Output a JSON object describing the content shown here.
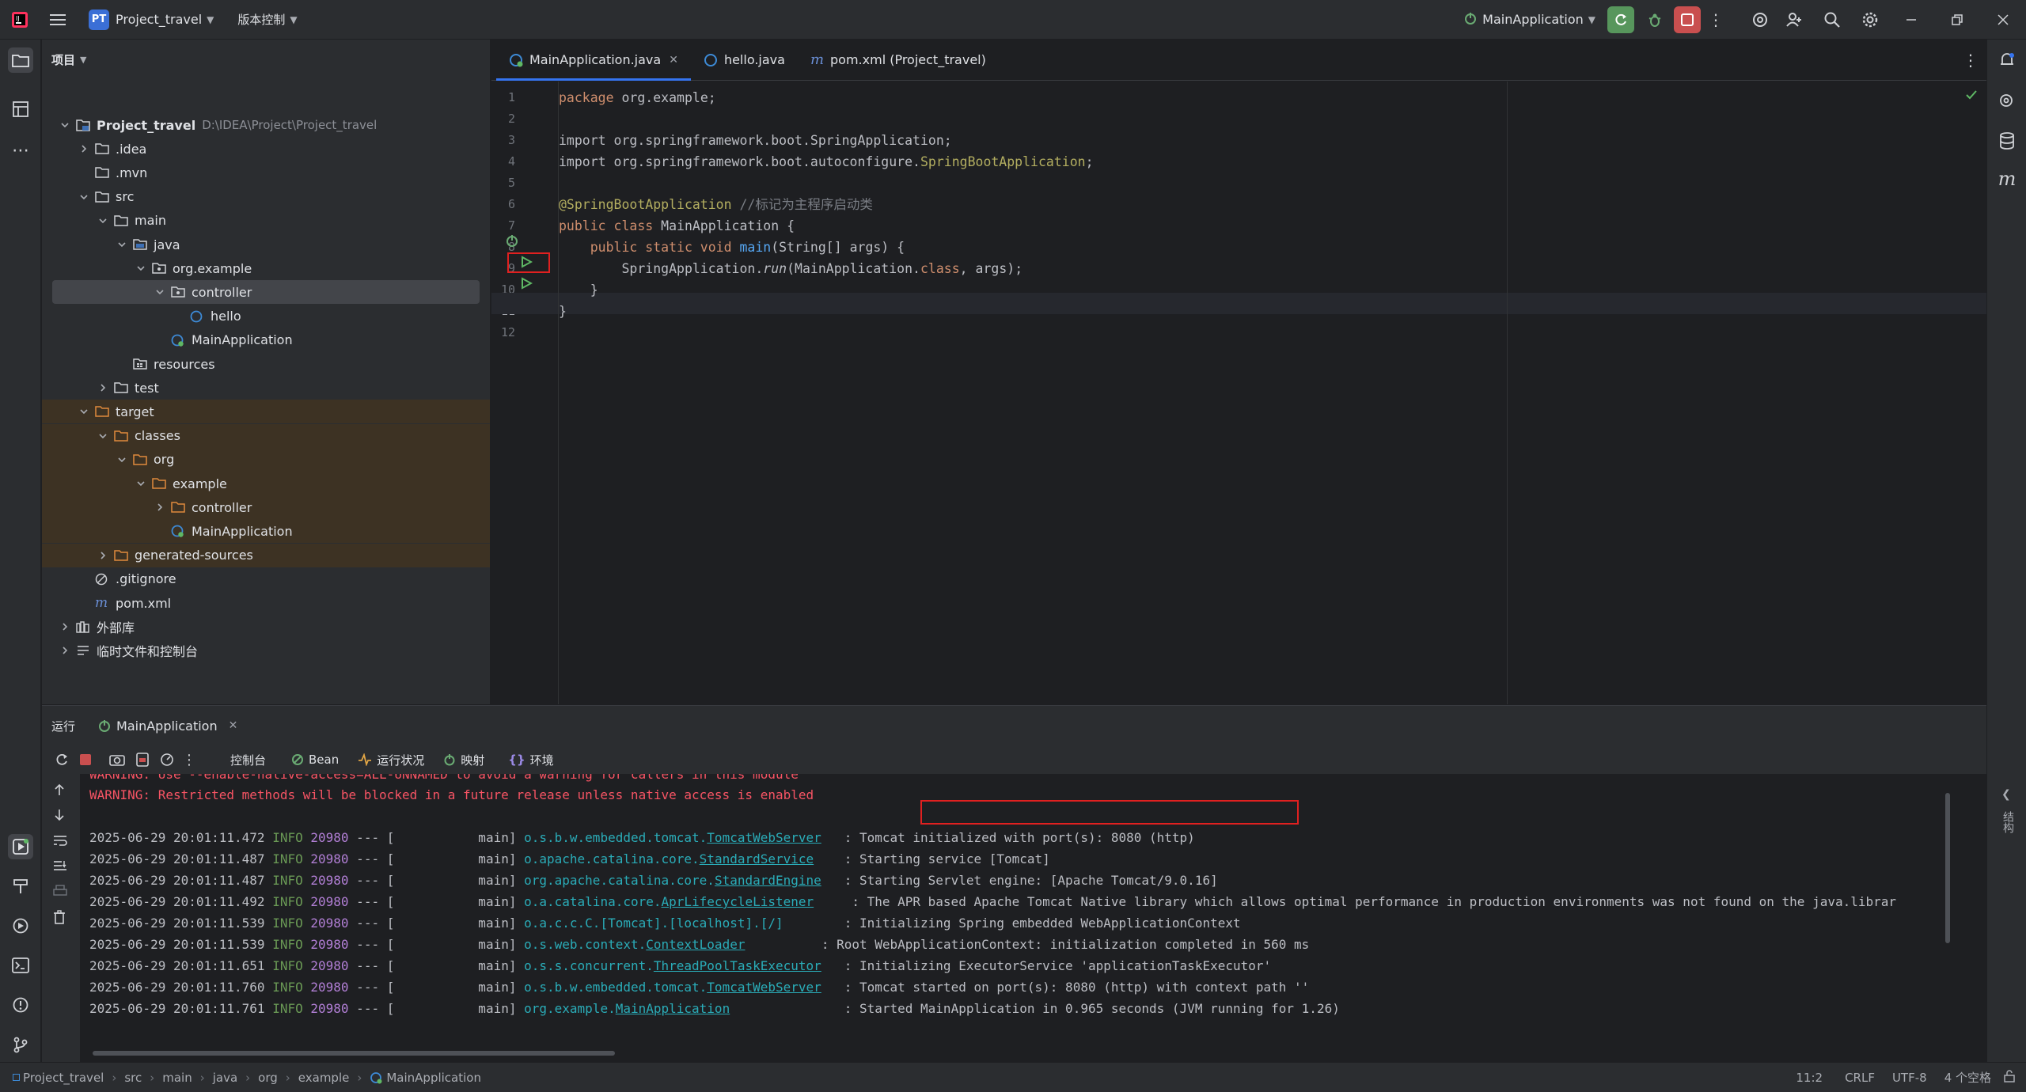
{
  "titlebar": {
    "project_badge": "PT",
    "project_name": "Project_travel",
    "vcs": "版本控制",
    "run_config": "MainApplication"
  },
  "project_panel": {
    "title": "项目",
    "tree": [
      {
        "label": "Project_travel",
        "path": "D:\\IDEA\\Project\\Project_travel"
      },
      {
        "label": ".idea"
      },
      {
        "label": ".mvn"
      },
      {
        "label": "src"
      },
      {
        "label": "main"
      },
      {
        "label": "java"
      },
      {
        "label": "org.example"
      },
      {
        "label": "controller"
      },
      {
        "label": "hello"
      },
      {
        "label": "MainApplication"
      },
      {
        "label": "resources"
      },
      {
        "label": "test"
      },
      {
        "label": "target"
      },
      {
        "label": "classes"
      },
      {
        "label": "org"
      },
      {
        "label": "example"
      },
      {
        "label": "controller"
      },
      {
        "label": "MainApplication"
      },
      {
        "label": "generated-sources"
      },
      {
        "label": ".gitignore"
      },
      {
        "label": "pom.xml"
      },
      {
        "label": "外部库"
      },
      {
        "label": "临时文件和控制台"
      }
    ]
  },
  "editor": {
    "tabs": [
      {
        "label": "MainApplication.java"
      },
      {
        "label": "hello.java"
      },
      {
        "label": "pom.xml (Project_travel)"
      }
    ],
    "line_numbers": [
      "1",
      "2",
      "3",
      "4",
      "5",
      "6",
      "7",
      "8",
      "9",
      "10",
      "11",
      "12"
    ],
    "code": {
      "l1": "package org.example;",
      "l3": "import org.springframework.boot.SpringApplication;",
      "l4a": "import org.springframework.boot.autoconfigure.",
      "l4b": "SpringBootApplication",
      ";": ";",
      "l6a": "@SpringBootApplication",
      "l6b": " //标记为主程序启动类",
      "l7a": "public class ",
      "l7b": "MainApplication {",
      "l8a": "    public static void ",
      "l8b": "main",
      "l8c": "(String[] args) {",
      "l9a": "        SpringApplication.",
      "l9b": "run",
      "l9c": "(MainApplication.",
      "l9d": "class",
      ", args);": ", args);",
      "l10": "    }",
      "l11": "}"
    }
  },
  "run_panel": {
    "tab_run": "运行",
    "tab_app": "MainApplication",
    "tools": {
      "console": "控制台",
      "bean": "Bean",
      "health": "运行状况",
      "mappings": "映射",
      "env": "环境"
    },
    "warn_top": "WARNING: Use --enable-native-access=ALL-UNNAMED to avoid a warning for callers in this module",
    "warn": "WARNING: Restricted methods will be blocked in a future release unless native access is enabled",
    "logs": [
      {
        "ts": "2025-06-29 20:01:11.472",
        "lvl": "INFO",
        "pid": "20980",
        "mid": " --- [           main] ",
        "lpre": "o.s.b.w.embedded.tomcat.",
        "lcls": "TomcatWebServer",
        "pad": "  ",
        "msg": ": Tomcat initialized with port(s): 8080 (http)"
      },
      {
        "ts": "2025-06-29 20:01:11.487",
        "lvl": "INFO",
        "pid": "20980",
        "mid": " --- [           main] ",
        "lpre": "o.apache.catalina.core.",
        "lcls": "StandardService",
        "pad": "   ",
        "msg": ": Starting service [Tomcat]"
      },
      {
        "ts": "2025-06-29 20:01:11.487",
        "lvl": "INFO",
        "pid": "20980",
        "mid": " --- [           main] ",
        "lpre": "org.apache.catalina.core.",
        "lcls": "StandardEngine",
        "pad": "  ",
        "msg": ": Starting Servlet engine: [Apache Tomcat/9.0.16]"
      },
      {
        "ts": "2025-06-29 20:01:11.492",
        "lvl": "INFO",
        "pid": "20980",
        "mid": " --- [           main] ",
        "lpre": "o.a.catalina.core.",
        "lcls": "AprLifecycleListener",
        "pad": "    ",
        "msg": ": The APR based Apache Tomcat Native library which allows optimal performance in production environments was not found on the java.librar"
      },
      {
        "ts": "2025-06-29 20:01:11.539",
        "lvl": "INFO",
        "pid": "20980",
        "mid": " --- [           main] ",
        "lpre": "o.a.c.c.C.[Tomcat].[localhost].[/]",
        "lcls": "",
        "pad": "       ",
        "msg": ": Initializing Spring embedded WebApplicationContext"
      },
      {
        "ts": "2025-06-29 20:01:11.539",
        "lvl": "INFO",
        "pid": "20980",
        "mid": " --- [           main] ",
        "lpre": "o.s.web.context.",
        "lcls": "ContextLoader",
        "pad": "         ",
        "msg": ": Root WebApplicationContext: initialization completed in 560 ms"
      },
      {
        "ts": "2025-06-29 20:01:11.651",
        "lvl": "INFO",
        "pid": "20980",
        "mid": " --- [           main] ",
        "lpre": "o.s.s.concurrent.",
        "lcls": "ThreadPoolTaskExecutor",
        "pad": "  ",
        "msg": ": Initializing ExecutorService 'applicationTaskExecutor'"
      },
      {
        "ts": "2025-06-29 20:01:11.760",
        "lvl": "INFO",
        "pid": "20980",
        "mid": " --- [           main] ",
        "lpre": "o.s.b.w.embedded.tomcat.",
        "lcls": "TomcatWebServer",
        "pad": "  ",
        "msg": ": Tomcat started on port(s): 8080 (http) with context path ''"
      },
      {
        "ts": "2025-06-29 20:01:11.761",
        "lvl": "INFO",
        "pid": "20980",
        "mid": " --- [           main] ",
        "lpre": "org.example.",
        "lcls": "MainApplication",
        "pad": "              ",
        "msg": ": Started MainApplication in 0.965 seconds (JVM running for 1.26)"
      }
    ]
  },
  "statusbar": {
    "crumbs": [
      "Project_travel",
      "src",
      "main",
      "java",
      "org",
      "example",
      "MainApplication"
    ],
    "position": "11:2",
    "line_sep": "CRLF",
    "encoding": "UTF-8",
    "indent": "4 个空格"
  },
  "side_label": "结构",
  "colors": {
    "accent": "#3574f0",
    "run_green": "#4caf50",
    "stop_red": "#e04b4b",
    "highlight": "#e02020"
  }
}
